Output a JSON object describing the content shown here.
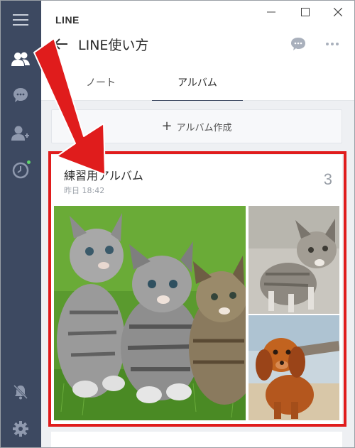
{
  "app": {
    "brand": "LINE"
  },
  "window_controls": [
    "minimize",
    "maximize",
    "close"
  ],
  "header": {
    "title": "LINE使い方",
    "back_icon": "arrow-left-icon",
    "chat_icon": "chat-bubble-icon",
    "more_icon": "more-icon"
  },
  "tabs": [
    {
      "label": "ノート",
      "active": false
    },
    {
      "label": "アルバム",
      "active": true
    }
  ],
  "create_album": {
    "icon": "+",
    "label": "アルバム作成"
  },
  "album": {
    "name": "練習用アルバム",
    "date": "昨日 18:42",
    "count": "3",
    "photos": [
      "kittens-photo",
      "kitten-photo",
      "puppy-photo"
    ]
  },
  "sidebar": {
    "items": [
      "menu-icon",
      "friends-icon",
      "chats-icon",
      "add-friend-icon",
      "timeline-icon",
      "notifications-off-icon",
      "settings-icon"
    ],
    "active": "friends-icon"
  },
  "colors": {
    "sidebar": "#3d4961",
    "highlight": "#e01c1c",
    "background": "#eef0f3"
  }
}
